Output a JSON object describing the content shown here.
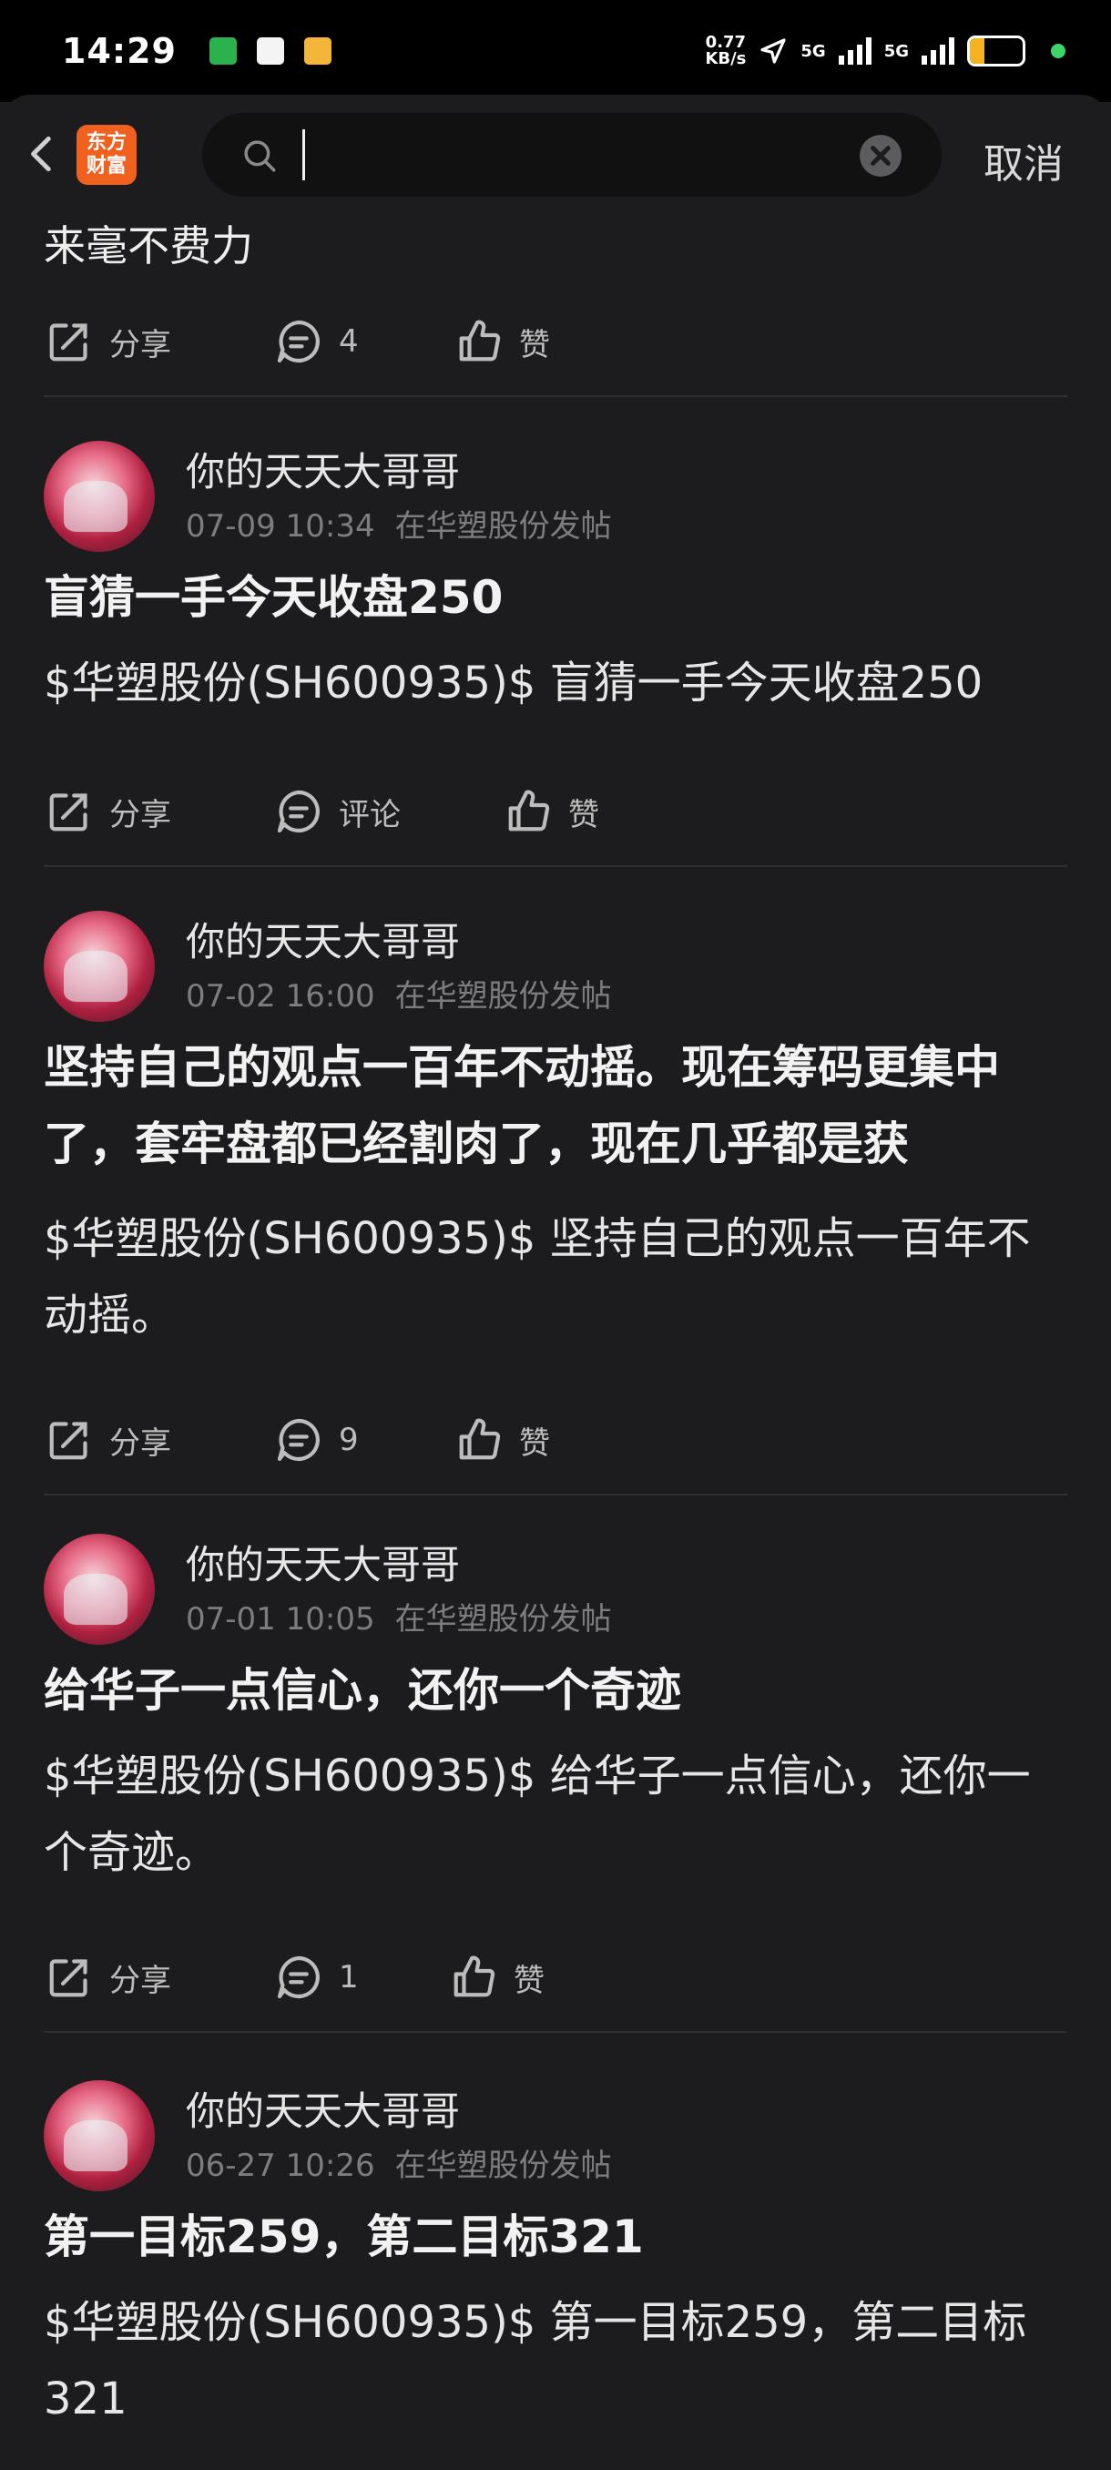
{
  "status_bar": {
    "time": "14:29",
    "net_speed_value": "0.77",
    "net_speed_unit": "KB/s",
    "network1": "5G",
    "network2": "5G",
    "battery": "28",
    "battery_level": 0.28,
    "notification_icons": [
      "wechat-icon",
      "app-icon",
      "folder-icon"
    ]
  },
  "header": {
    "logo_line1": "东方",
    "logo_line2": "财富",
    "search_value": "",
    "cancel_label": "取消"
  },
  "feed": {
    "prev_text": "来毫不费力",
    "prev_actions": {
      "share": "分享",
      "comment": "4",
      "like": "赞"
    },
    "posts": [
      {
        "user": "你的天天大哥哥",
        "time": "07-09 10:34",
        "source": "在华塑股份发帖",
        "title": "盲猜一手今天收盘250",
        "body": "$华塑股份(SH600935)$ 盲猜一手今天收盘250",
        "share": "分享",
        "comment": "评论",
        "like": "赞"
      },
      {
        "user": "你的天天大哥哥",
        "time": "07-02 16:00",
        "source": "在华塑股份发帖",
        "title": "坚持自己的观点一百年不动摇。现在筹码更集中了，套牢盘都已经割肉了，现在几乎都是获",
        "body": "$华塑股份(SH600935)$ 坚持自己的观点一百年不动摇。",
        "share": "分享",
        "comment": "9",
        "like": "赞"
      },
      {
        "user": "你的天天大哥哥",
        "time": "07-01 10:05",
        "source": "在华塑股份发帖",
        "title": "给华子一点信心，还你一个奇迹",
        "body": "$华塑股份(SH600935)$ 给华子一点信心，还你一个奇迹。",
        "share": "分享",
        "comment": "1",
        "like": "赞"
      },
      {
        "user": "你的天天大哥哥",
        "time": "06-27 10:26",
        "source": "在华塑股份发帖",
        "title": "第一目标259，第二目标321",
        "body": "$华塑股份(SH600935)$ 第一目标259，第二目标321",
        "share": "分享",
        "comment": "",
        "like": ""
      }
    ]
  }
}
